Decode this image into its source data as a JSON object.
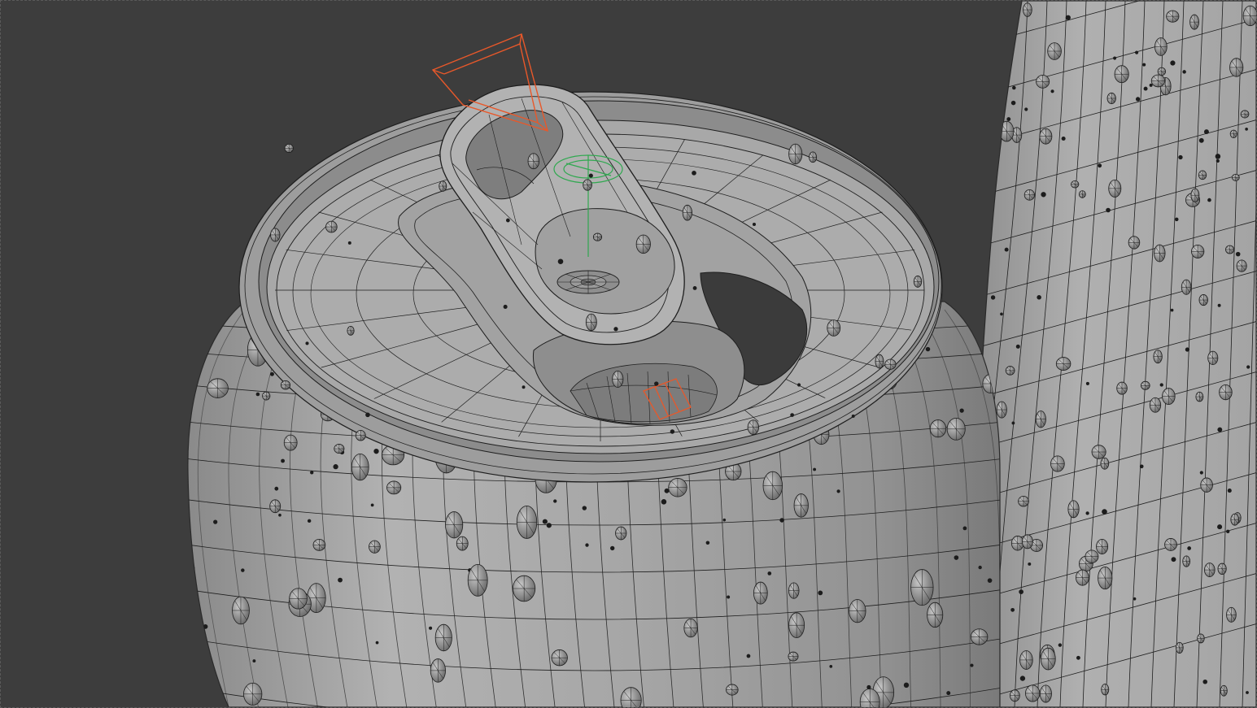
{
  "viewport": {
    "background": "#3d3d3d",
    "mesh_fill": "#a3a3a3",
    "mesh_fill_light": "#b4b4b4",
    "mesh_fill_dark": "#7b7b7b",
    "wire_color": "#1e1e1e",
    "selection_color": "#e8582a",
    "gizmo_color": "#2fa84f"
  },
  "scene": {
    "objects": [
      "can-body",
      "can-lid",
      "pull-tab",
      "tall-can",
      "condensation-droplets"
    ],
    "shading": "solid-wireframe"
  }
}
